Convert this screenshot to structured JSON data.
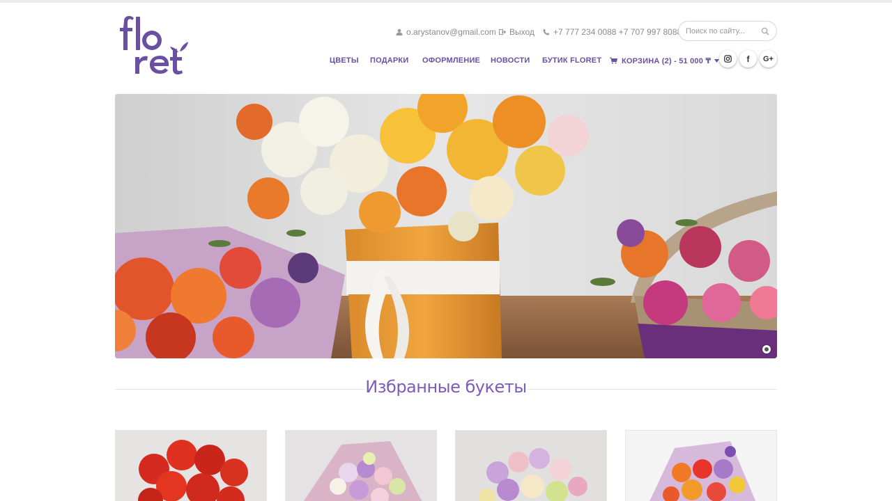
{
  "header": {
    "logo_text": "floret",
    "user_email": "o.arystanov@gmail.com",
    "logout_label": "Выход",
    "phones": "+7 777 234 0088 +7 707 997 8088",
    "search_placeholder": "Поиск по сайту..."
  },
  "nav": {
    "items": [
      {
        "label": "ЦВЕТЫ"
      },
      {
        "label": "ПОДАРКИ"
      },
      {
        "label": "ОФОРМЛЕНИЕ"
      },
      {
        "label": "НОВОСТИ"
      },
      {
        "label": "БУТИК FLORET"
      }
    ],
    "cart_label": "КОРЗИНА (2) - 51 000 ₸"
  },
  "social": [
    {
      "icon": "instagram-icon"
    },
    {
      "icon": "facebook-icon",
      "glyph": "f"
    },
    {
      "icon": "google-plus-icon",
      "glyph": "G+"
    }
  ],
  "hero": {
    "slide_count": 1,
    "active_slide": 1
  },
  "featured": {
    "title": "Избранные букеты",
    "products": [
      {
        "name": "red-roses-bouquet"
      },
      {
        "name": "pastel-wrapped-bouquet"
      },
      {
        "name": "lilac-mixed-bouquet"
      },
      {
        "name": "bright-mixed-bouquet"
      }
    ]
  },
  "colors": {
    "brand_purple": "#6a4fa3",
    "title_purple": "#7d5bbd",
    "muted_text": "#8a8a8a"
  }
}
